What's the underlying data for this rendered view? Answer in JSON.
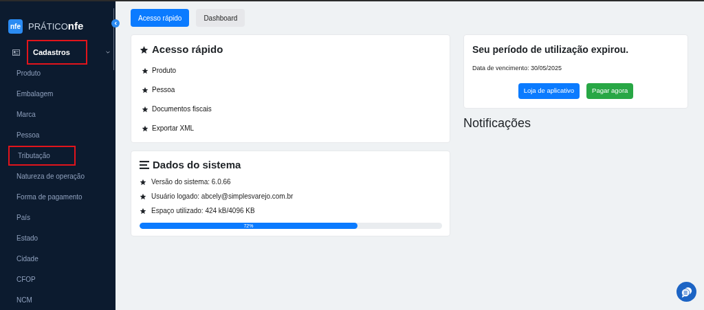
{
  "logo": {
    "icon_text": "nfe",
    "name": "PRÁTICO",
    "name_bold": "nfe"
  },
  "sidebar": {
    "group": {
      "label": "Cadastros",
      "expanded": true,
      "highlighted": true
    },
    "items": [
      {
        "label": "Produto",
        "highlighted": false
      },
      {
        "label": "Embalagem",
        "highlighted": false
      },
      {
        "label": "Marca",
        "highlighted": false
      },
      {
        "label": "Pessoa",
        "highlighted": false
      },
      {
        "label": "Tributação",
        "highlighted": true
      },
      {
        "label": "Natureza de operação",
        "highlighted": false
      },
      {
        "label": "Forma de pagamento",
        "highlighted": false
      },
      {
        "label": "País",
        "highlighted": false
      },
      {
        "label": "Estado",
        "highlighted": false
      },
      {
        "label": "Cidade",
        "highlighted": false
      },
      {
        "label": "CFOP",
        "highlighted": false
      },
      {
        "label": "NCM",
        "highlighted": false
      }
    ]
  },
  "tabs": [
    {
      "label": "Acesso rápido",
      "selected": true
    },
    {
      "label": "Dashboard",
      "selected": false
    }
  ],
  "quick_access": {
    "title": "Acesso rápido",
    "items": [
      "Produto",
      "Pessoa",
      "Documentos fiscais",
      "Exportar XML"
    ]
  },
  "system_data": {
    "title": "Dados do sistema",
    "lines": [
      "Versão do sistema: 6.0.66",
      "Usuário logado: abcely@simplesvarejo.com.br",
      "Espaço utilizado: 424 kB/4096 KB"
    ],
    "usage": {
      "level": 0.72,
      "label": "72%"
    }
  },
  "expiry": {
    "title": "Seu período de utilização expirou.",
    "due": "Data de vencimento: 30/05/2025",
    "buttons": [
      {
        "label": "Loja de aplicativo",
        "kind": "primary"
      },
      {
        "label": "Pagar agora",
        "kind": "success"
      }
    ]
  },
  "notifications": {
    "title": "Notificações"
  }
}
